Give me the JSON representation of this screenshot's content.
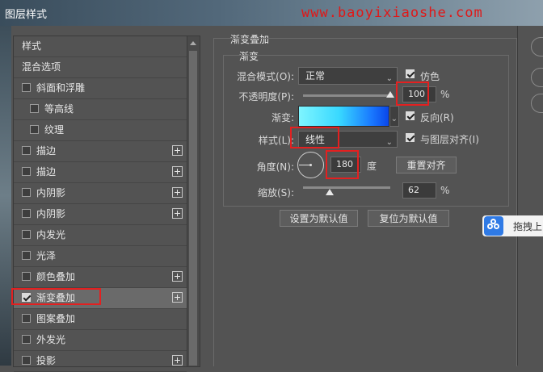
{
  "window": {
    "title": "图层样式",
    "watermark": "www.baoyixiaoshe.com"
  },
  "sidebar": {
    "items": [
      {
        "label": "样式",
        "type": "header",
        "checkbox": false,
        "plus": false
      },
      {
        "label": "混合选项",
        "type": "header",
        "checkbox": false,
        "plus": false
      },
      {
        "label": "斜面和浮雕",
        "checkbox": true,
        "checked": false,
        "plus": false,
        "indent": 0
      },
      {
        "label": "等高线",
        "checkbox": true,
        "checked": false,
        "plus": false,
        "indent": 1
      },
      {
        "label": "纹理",
        "checkbox": true,
        "checked": false,
        "plus": false,
        "indent": 1
      },
      {
        "label": "描边",
        "checkbox": true,
        "checked": false,
        "plus": true,
        "indent": 0
      },
      {
        "label": "描边",
        "checkbox": true,
        "checked": false,
        "plus": true,
        "indent": 0
      },
      {
        "label": "内阴影",
        "checkbox": true,
        "checked": false,
        "plus": true,
        "indent": 0
      },
      {
        "label": "内阴影",
        "checkbox": true,
        "checked": false,
        "plus": true,
        "indent": 0
      },
      {
        "label": "内发光",
        "checkbox": true,
        "checked": false,
        "plus": false,
        "indent": 0
      },
      {
        "label": "光泽",
        "checkbox": true,
        "checked": false,
        "plus": false,
        "indent": 0
      },
      {
        "label": "颜色叠加",
        "checkbox": true,
        "checked": false,
        "plus": true,
        "indent": 0
      },
      {
        "label": "渐变叠加",
        "checkbox": true,
        "checked": true,
        "plus": true,
        "indent": 0,
        "selected": true
      },
      {
        "label": "图案叠加",
        "checkbox": true,
        "checked": false,
        "plus": false,
        "indent": 0
      },
      {
        "label": "外发光",
        "checkbox": true,
        "checked": false,
        "plus": false,
        "indent": 0
      },
      {
        "label": "投影",
        "checkbox": true,
        "checked": false,
        "plus": true,
        "indent": 0
      }
    ]
  },
  "panel": {
    "section_title": "渐变叠加",
    "group_title": "渐变",
    "blend_mode": {
      "label": "混合模式(O):",
      "value": "正常"
    },
    "dither": {
      "label": "仿色",
      "checked": true
    },
    "opacity": {
      "label": "不透明度(P):",
      "value": "100",
      "unit": "%",
      "level": 1.0
    },
    "gradient": {
      "label": "渐变:",
      "colors": [
        "#7ff5ff",
        "#38d8ff",
        "#1a7bff",
        "#0a46ea"
      ]
    },
    "reverse": {
      "label": "反向(R)",
      "checked": true
    },
    "style": {
      "label": "样式(L):",
      "value": "线性"
    },
    "align": {
      "label": "与图层对齐(I)",
      "checked": true
    },
    "angle": {
      "label": "角度(N):",
      "value": "180",
      "unit": "度"
    },
    "reset_align_button": "重置对齐",
    "scale": {
      "label": "缩放(S):",
      "value": "62",
      "unit": "%",
      "level": 0.31
    },
    "default_button": "设置为默认值",
    "reset_default_button": "复位为默认值"
  },
  "tooltip": {
    "text": "拖拽上"
  },
  "colors": {
    "highlight": "#e32020",
    "panel_bg": "#535353"
  }
}
